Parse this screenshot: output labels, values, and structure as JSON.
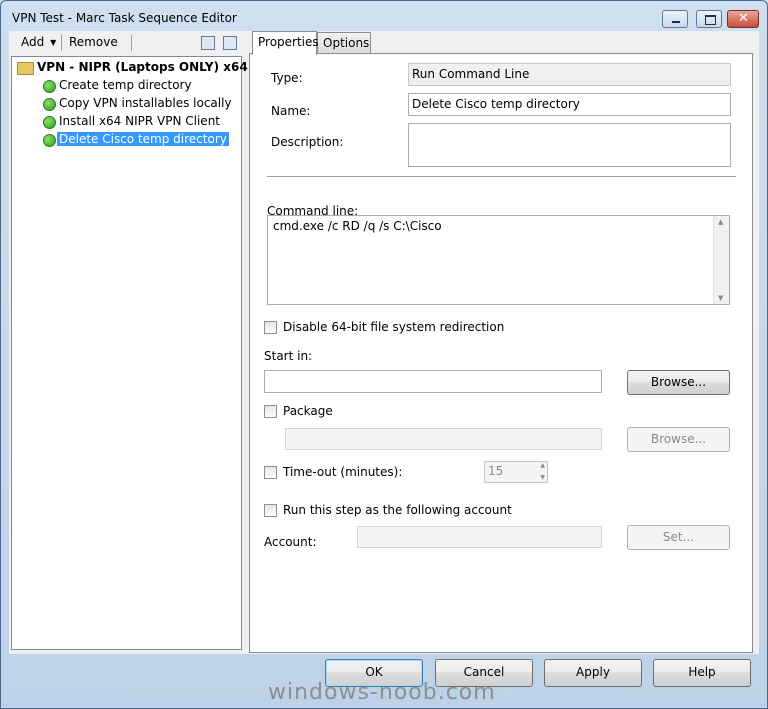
{
  "window": {
    "title": "VPN Test - Marc Task Sequence Editor"
  },
  "toolbar": {
    "add_label": "Add",
    "remove_label": "Remove"
  },
  "tree": {
    "root": "VPN - NIPR (Laptops ONLY) x64",
    "items": [
      {
        "label": "Create temp directory"
      },
      {
        "label": "Copy VPN installables locally"
      },
      {
        "label": "Install x64 NIPR VPN Client"
      },
      {
        "label": "Delete Cisco temp directory",
        "selected": true
      }
    ]
  },
  "tabs": [
    {
      "label": "Properties",
      "active": true
    },
    {
      "label": "Options",
      "active": false
    }
  ],
  "properties": {
    "type_label": "Type:",
    "type_value": "Run Command Line",
    "name_label": "Name:",
    "name_value": "Delete Cisco temp directory",
    "description_label": "Description:",
    "description_value": "",
    "command_label": "Command line:",
    "command_value": "cmd.exe /c RD /q /s C:\\Cisco",
    "disable_redirect_label": "Disable 64-bit file system redirection",
    "start_in_label": "Start in:",
    "start_in_value": "",
    "browse_label": "Browse...",
    "package_label": "Package",
    "package_browse_label": "Browse...",
    "timeout_label": "Time-out (minutes):",
    "timeout_value": "15",
    "run_as_label": "Run this step as the following account",
    "account_label": "Account:",
    "set_label": "Set..."
  },
  "buttons": {
    "ok": "OK",
    "cancel": "Cancel",
    "apply": "Apply",
    "help": "Help"
  },
  "watermark": "windows-noob.com",
  "colors": {
    "selection": "#3399ff",
    "window_frame": "#bdd2e8"
  }
}
